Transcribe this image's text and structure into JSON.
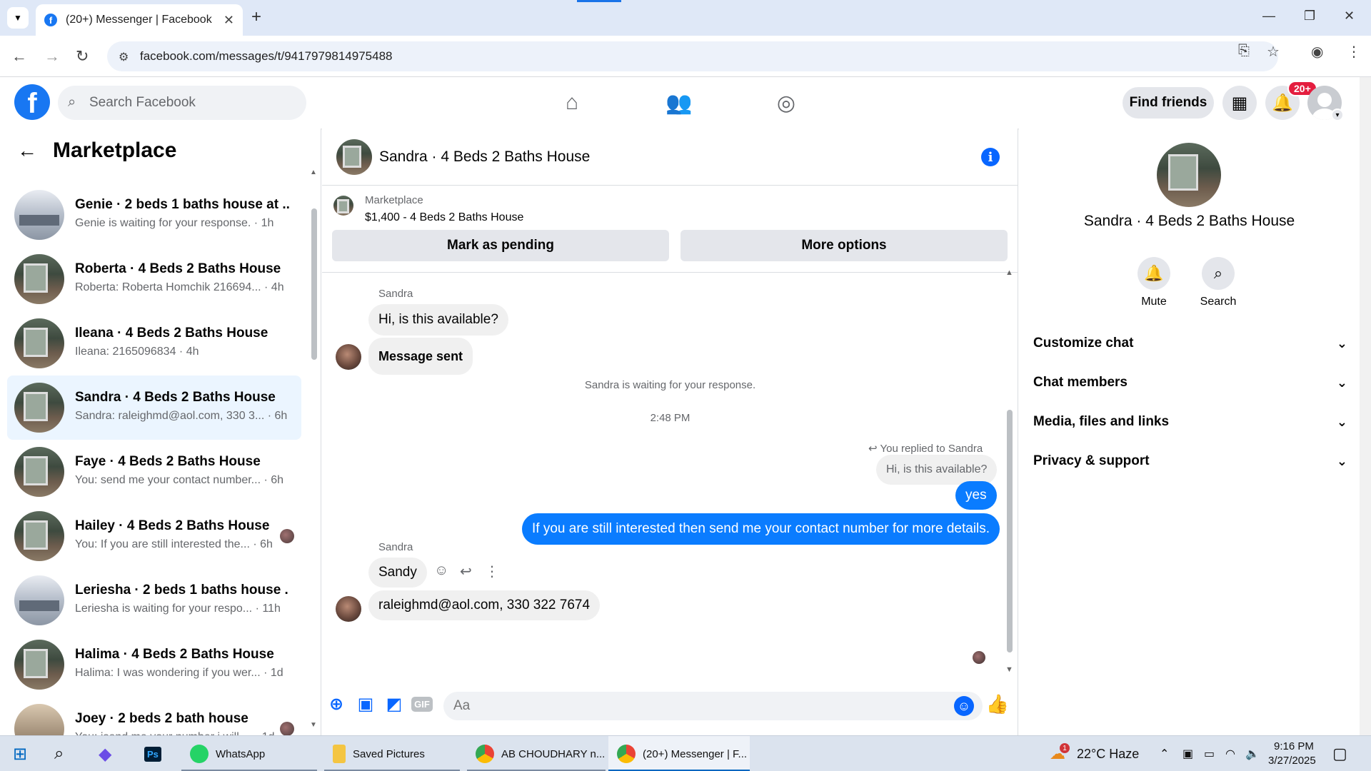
{
  "browser": {
    "tab_title": "(20+) Messenger | Facebook",
    "url": "facebook.com/messages/t/9417979814975488"
  },
  "fb_header": {
    "search_placeholder": "Search Facebook",
    "find_friends": "Find friends",
    "notification_badge": "20+"
  },
  "sidebar": {
    "title": "Marketplace",
    "conversations": [
      {
        "name": "Genie · 2 beds 1 baths house at ...",
        "snippet": "Genie is waiting for your response. · 1h",
        "thumb": "kitchen"
      },
      {
        "name": "Roberta · 4 Beds 2 Baths House",
        "snippet": "Roberta: Roberta Homchik 216694... · 4h",
        "thumb": "house"
      },
      {
        "name": "Ileana · 4 Beds 2 Baths House",
        "snippet": "Ileana: 2165096834 · 4h",
        "thumb": "house"
      },
      {
        "name": "Sandra · 4 Beds 2 Baths House",
        "snippet": "Sandra: raleighmd@aol.com, 330 3... · 6h",
        "thumb": "house",
        "active": true
      },
      {
        "name": "Faye · 4 Beds 2 Baths House",
        "snippet": "You: send me your contact number... · 6h",
        "thumb": "house"
      },
      {
        "name": "Hailey · 4 Beds 2 Baths House",
        "snippet": "You: If you are still interested the... · 6h",
        "thumb": "house",
        "seen": true
      },
      {
        "name": "Leriesha · 2 beds 1 baths house ...",
        "snippet": "Leriesha is waiting for your respo... · 11h",
        "thumb": "kitchen"
      },
      {
        "name": "Halima · 4 Beds 2 Baths House",
        "snippet": "Halima: I was wondering if you wer... · 1d",
        "thumb": "house"
      },
      {
        "name": "Joey · 2 beds 2 bath house",
        "snippet": "You: isend me your number i will ... · 1d",
        "thumb": "room",
        "seen": true
      }
    ]
  },
  "chat": {
    "title": "Sandra · 4 Beds 2 Baths House",
    "marketplace_label": "Marketplace",
    "listing": "$1,400 - 4 Beds 2 Baths House",
    "mark_pending": "Mark as pending",
    "more_options": "More options",
    "sender_1": "Sandra",
    "msg_1": "Hi, is this available?",
    "msg_2": "Message sent",
    "waiting": "Sandra is waiting for your response.",
    "timestamp": "2:48 PM",
    "reply_note": "You replied to Sandra",
    "quoted": "Hi, is this available?",
    "out_1": "yes",
    "out_2": "If you are still interested then send me your contact number for more details.",
    "sender_2": "Sandra",
    "msg_3": "Sandy",
    "msg_4": "raleighmd@aol.com, 330 322 7674",
    "composer_placeholder": "Aa"
  },
  "right_panel": {
    "title": "Sandra · 4 Beds 2 Baths House",
    "mute": "Mute",
    "search": "Search",
    "rows": [
      "Customize chat",
      "Chat members",
      "Media, files and links",
      "Privacy & support"
    ]
  },
  "taskbar": {
    "whatsapp": "WhatsApp",
    "saved_pictures": "Saved Pictures",
    "chrome_1": "AB CHOUDHARY n...",
    "chrome_2": "(20+) Messenger | F...",
    "weather": "22°C  Haze",
    "weather_badge": "1",
    "time": "9:16 PM",
    "date": "3/27/2025"
  },
  "colors": {
    "fb_blue": "#1877f2",
    "messenger_blue": "#0a7cff",
    "active_row": "#ebf5ff",
    "badge_red": "#e41e3f"
  }
}
